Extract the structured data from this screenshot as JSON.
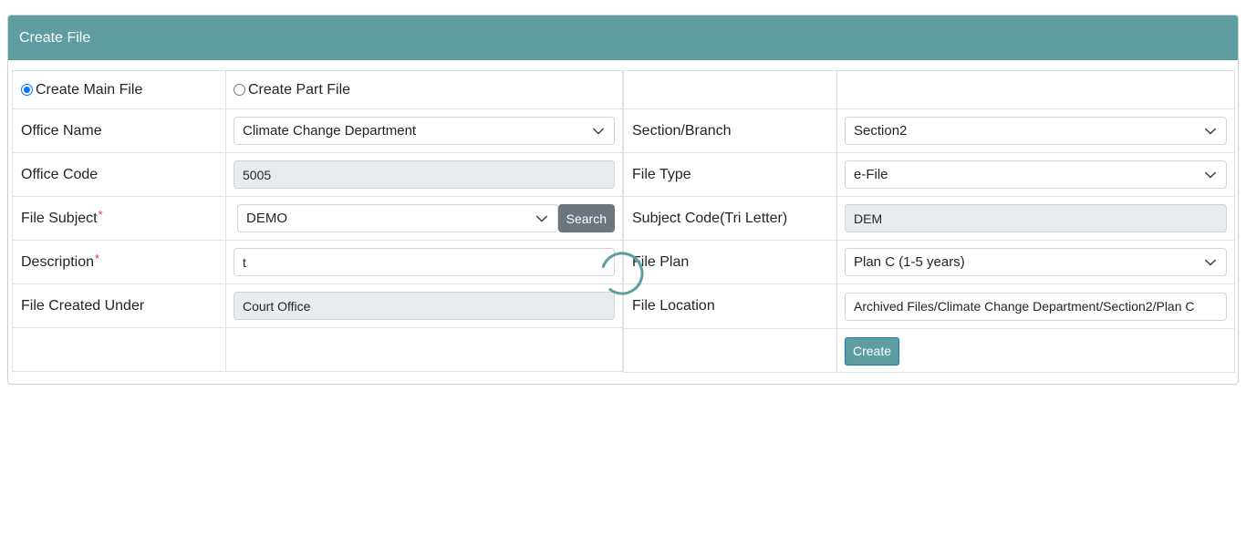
{
  "header": {
    "title": "Create File"
  },
  "file_kind": {
    "main_label": "Create Main File",
    "part_label": "Create Part File",
    "selected": "main"
  },
  "left": {
    "office_name": {
      "label": "Office Name",
      "value": "Climate Change Department"
    },
    "office_code": {
      "label": "Office Code",
      "value": "5005"
    },
    "file_subject": {
      "label": "File Subject",
      "required_mark": "*",
      "value": "DEMO",
      "search_label": "Search"
    },
    "description": {
      "label": "Description",
      "required_mark": "*",
      "value": "t"
    },
    "file_created_under": {
      "label": "File Created Under",
      "value": "Court Office"
    }
  },
  "right": {
    "section_branch": {
      "label": "Section/Branch",
      "value": "Section2"
    },
    "file_type": {
      "label": "File Type",
      "value": "e-File"
    },
    "subject_code": {
      "label": "Subject Code(Tri Letter)",
      "value": "DEM"
    },
    "file_plan": {
      "label": "File Plan",
      "value": "Plan C (1-5 years)"
    },
    "file_location": {
      "label": "File Location",
      "value": "Archived Files/Climate Change Department/Section2/Plan C"
    },
    "create_label": "Create"
  },
  "colors": {
    "header_bg": "#5f9ea0",
    "create_button_bg": "#5f9ea0",
    "search_button_bg": "#6c757d",
    "required": "#dc3545",
    "readonly_bg": "#e9ecef"
  },
  "icons": {
    "select_arrow": "chevron-down-icon",
    "loading": "loading-spinner-icon"
  }
}
